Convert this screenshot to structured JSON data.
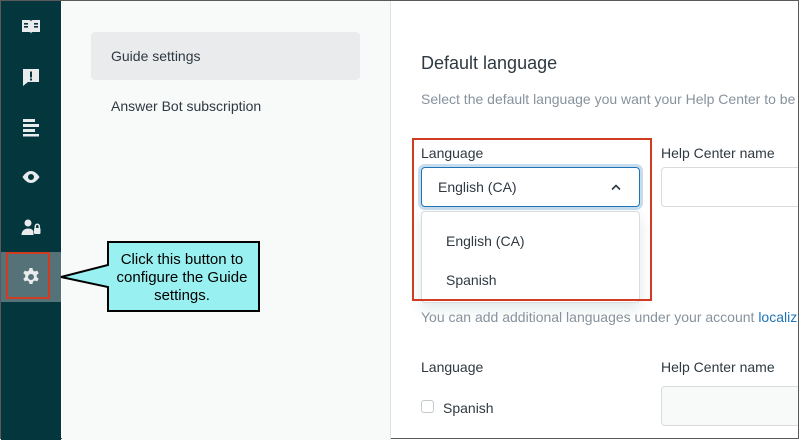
{
  "sidebar": {
    "items": [
      {
        "icon": "book-icon"
      },
      {
        "icon": "alert-icon"
      },
      {
        "icon": "list-icon"
      },
      {
        "icon": "eye-icon"
      },
      {
        "icon": "user-lock-icon"
      },
      {
        "icon": "gear-icon",
        "active": true
      }
    ]
  },
  "subnav": {
    "items": [
      {
        "label": "Guide settings",
        "active": true
      },
      {
        "label": "Answer Bot subscription"
      }
    ]
  },
  "main": {
    "title": "Default language",
    "description": "Select the default language you want your Help Center to be",
    "language_label": "Language",
    "selected_language": "English (CA)",
    "help_center_label": "Help Center name",
    "dropdown_options": [
      "English (CA)",
      "Spanish"
    ],
    "note_text": "You can add additional languages under your account ",
    "note_link": "localiza",
    "language_label_2": "Language",
    "help_center_label_2": "Help Center name",
    "checkbox_label": "Spanish"
  },
  "callout": {
    "text": "Click this button to configure the Guide settings."
  },
  "colors": {
    "sidebar_bg": "#03363d",
    "highlight": "#d03b22",
    "callout_bg": "#99f0f0",
    "link": "#1f73b7"
  }
}
